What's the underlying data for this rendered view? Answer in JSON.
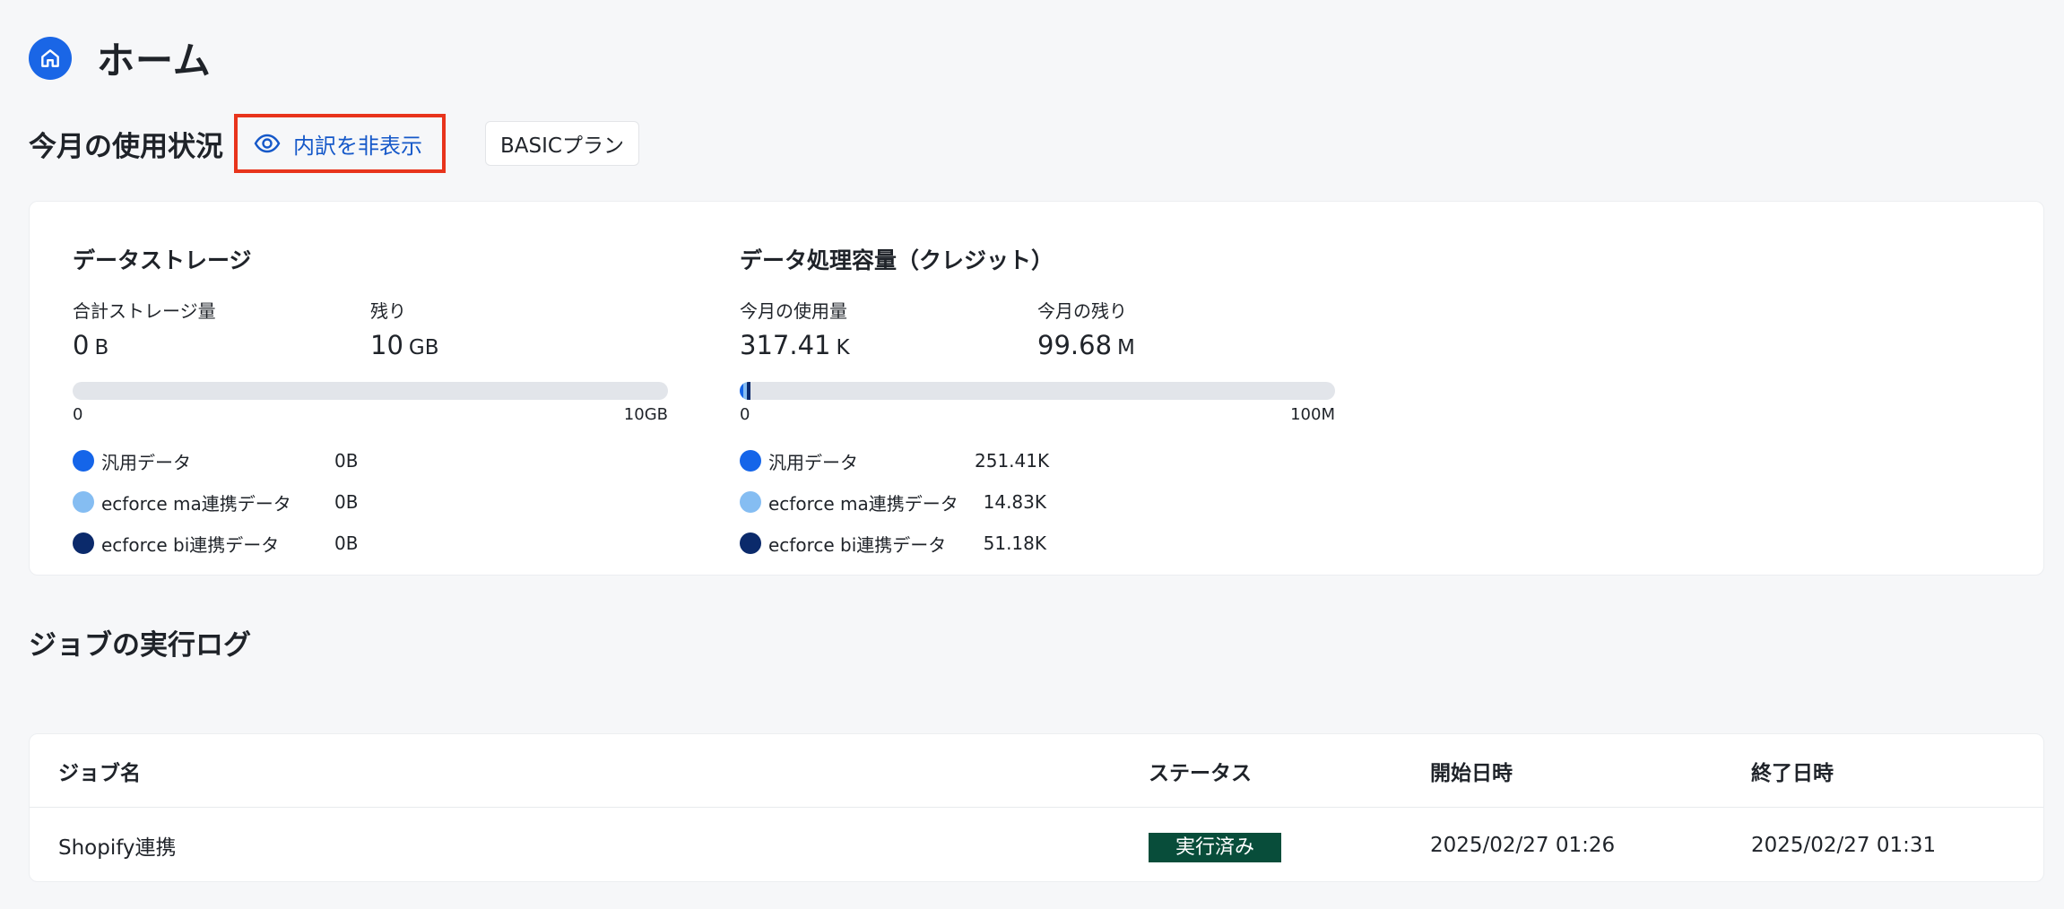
{
  "header": {
    "title": "ホーム",
    "icon": "home-icon"
  },
  "usage": {
    "title": "今月の使用状況",
    "toggle_label": "内訳を非表示",
    "plan_label": "BASICプラン",
    "colors": {
      "general": "#1565e9",
      "ma": "#85bdf2",
      "bi": "#0b2a6b"
    },
    "storage": {
      "title": "データストレージ",
      "total_label": "合計ストレージ量",
      "total_value": "0",
      "total_unit": "B",
      "remaining_label": "残り",
      "remaining_value": "10",
      "remaining_unit": "GB",
      "scale_min": "0",
      "scale_max": "10GB",
      "segments": [
        0,
        0,
        0
      ],
      "legend": [
        {
          "label": "汎用データ",
          "value": "0B"
        },
        {
          "label": "ecforce ma連携データ",
          "value": "0B"
        },
        {
          "label": "ecforce bi連携データ",
          "value": "0B"
        }
      ]
    },
    "credit": {
      "title": "データ処理容量（クレジット）",
      "used_label": "今月の使用量",
      "used_value": "317.41",
      "used_unit": "K",
      "remaining_label": "今月の残り",
      "remaining_value": "99.68",
      "remaining_unit": "M",
      "scale_min": "0",
      "scale_max": "100M",
      "segments": [
        0.0025141,
        0.0001483,
        0.0005118
      ],
      "legend": [
        {
          "label": "汎用データ",
          "value": "251.41K"
        },
        {
          "label": "ecforce ma連携データ",
          "value": "14.83K"
        },
        {
          "label": "ecforce bi連携データ",
          "value": "51.18K"
        }
      ]
    }
  },
  "jobs": {
    "title": "ジョブの実行ログ",
    "columns": [
      "ジョブ名",
      "ステータス",
      "開始日時",
      "終了日時"
    ],
    "rows": [
      {
        "name": "Shopify連携",
        "status": "実行済み",
        "start": "2025/02/27 01:26",
        "end": "2025/02/27 01:31"
      }
    ]
  }
}
